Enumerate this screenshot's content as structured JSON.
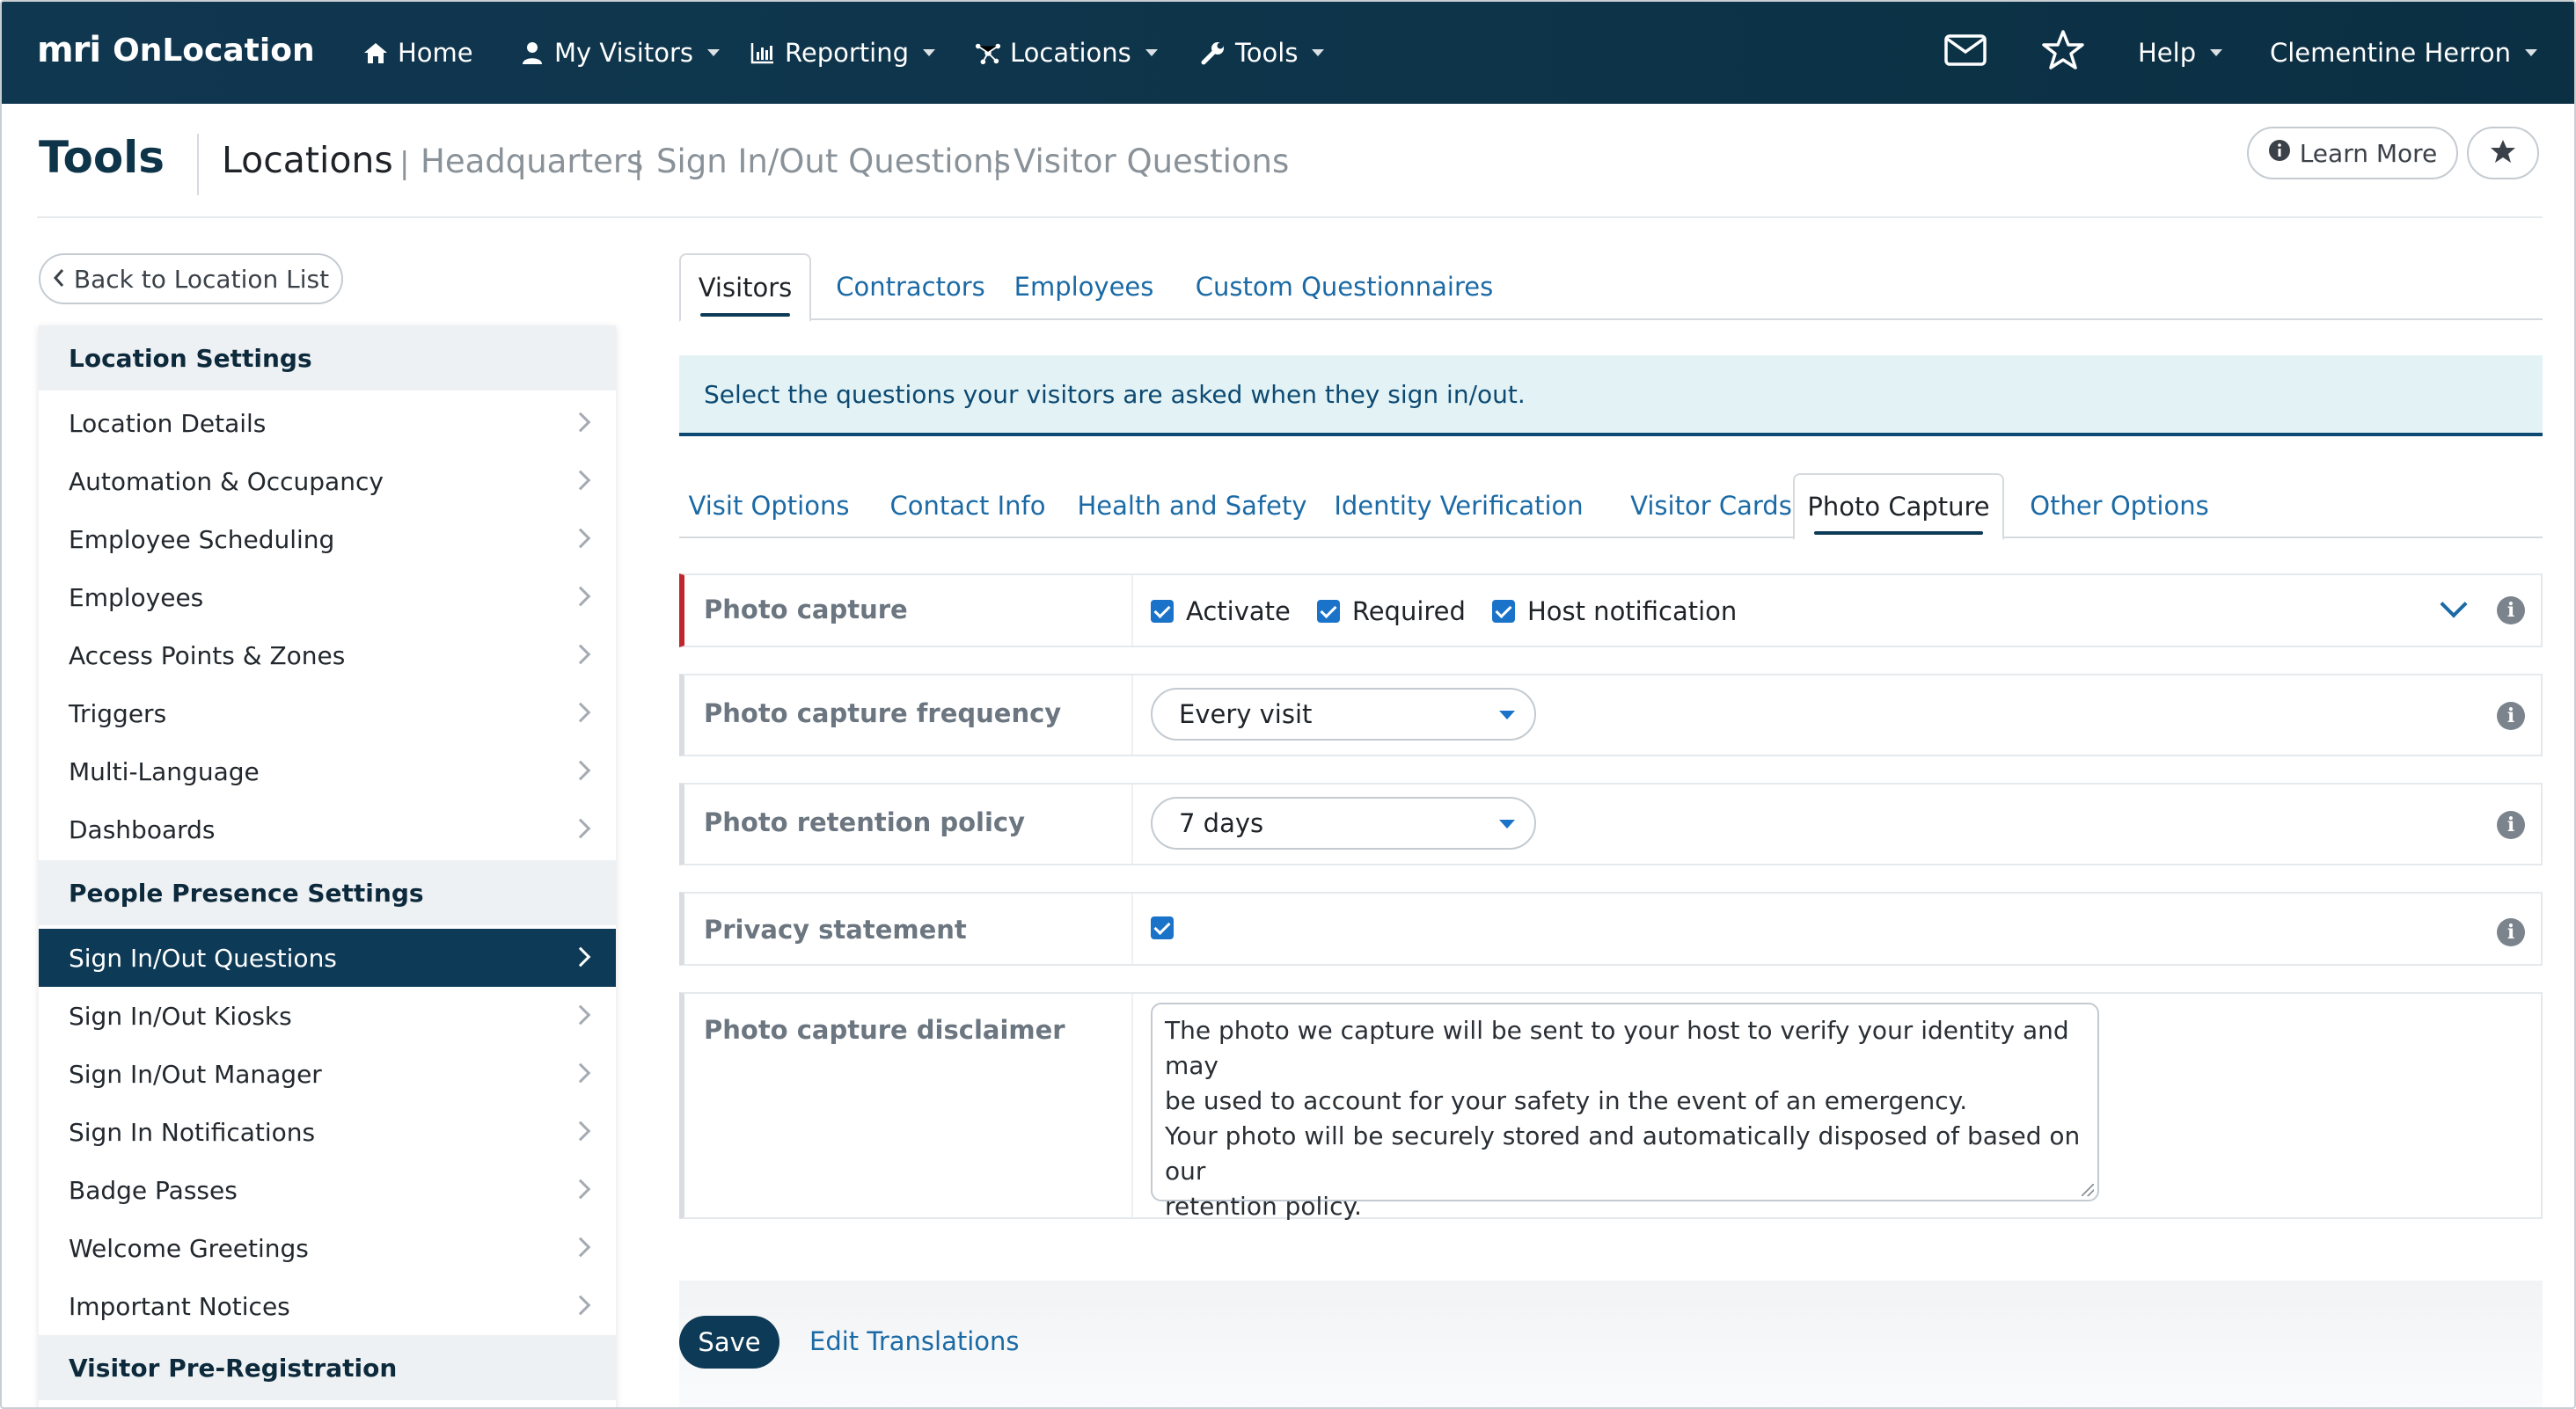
{
  "nav": {
    "logo_mark": "mri",
    "logo_text": "OnLocation",
    "items": [
      {
        "label": "Home",
        "icon": "home-icon"
      },
      {
        "label": "My Visitors",
        "icon": "person-icon"
      },
      {
        "label": "Reporting",
        "icon": "chart-icon"
      },
      {
        "label": "Locations",
        "icon": "network-icon"
      },
      {
        "label": "Tools",
        "icon": "wrench-icon"
      }
    ],
    "help": "Help",
    "user": "Clementine Herron"
  },
  "header": {
    "title": "Tools",
    "breadcrumbs": [
      "Locations",
      "Headquarters",
      "Sign In/Out Questions",
      "Visitor Questions"
    ],
    "separator": "|",
    "learn_more": "Learn More"
  },
  "sidebar": {
    "back": "Back to Location List",
    "sections": [
      {
        "title": "Location Settings",
        "items": [
          "Location Details",
          "Automation & Occupancy",
          "Employee Scheduling",
          "Employees",
          "Access Points & Zones",
          "Triggers",
          "Multi-Language",
          "Dashboards"
        ]
      },
      {
        "title": "People Presence Settings",
        "items": [
          "Sign In/Out Questions",
          "Sign In/Out Kiosks",
          "Sign In/Out Manager",
          "Sign In Notifications",
          "Badge Passes",
          "Welcome Greetings",
          "Important Notices"
        ]
      },
      {
        "title": "Visitor Pre-Registration",
        "items": []
      }
    ],
    "active_item": "Sign In/Out Questions"
  },
  "tabs": [
    "Visitors",
    "Contractors",
    "Employees",
    "Custom Questionnaires"
  ],
  "active_tab": "Visitors",
  "banner": "Select the questions your visitors are asked when they sign in/out.",
  "subtabs": [
    "Visit Options",
    "Contact Info",
    "Health and Safety",
    "Identity Verification",
    "Visitor Cards",
    "Photo Capture",
    "Other Options"
  ],
  "active_subtab": "Photo Capture",
  "form": {
    "photo_capture": {
      "label": "Photo capture",
      "activate": "Activate",
      "required": "Required",
      "host_notification": "Host notification"
    },
    "frequency": {
      "label": "Photo capture frequency",
      "value": "Every visit"
    },
    "retention": {
      "label": "Photo retention policy",
      "value": "7 days"
    },
    "privacy": {
      "label": "Privacy statement"
    },
    "disclaimer": {
      "label": "Photo capture disclaimer",
      "lines": [
        "The photo we capture will be sent to your host to verify your identity and may",
        "be used to account for your safety in the event of an emergency.",
        "Your photo will be securely stored and automatically disposed of based on our",
        "retention policy."
      ]
    }
  },
  "footer": {
    "save": "Save",
    "edit_translations": "Edit Translations"
  },
  "colors": {
    "nav_bg": "#0d3449",
    "accent": "#1b6aa5",
    "active": "#0d3a57",
    "error": "#c0262d",
    "banner_bg": "#e3f3f5"
  }
}
